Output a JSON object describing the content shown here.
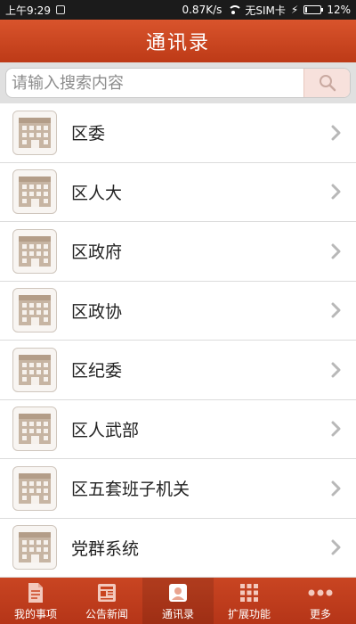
{
  "status_bar": {
    "time": "上午9:29",
    "speed": "0.87K/s",
    "sim": "无SIM卡",
    "battery": "12%",
    "battery_level": 0.12
  },
  "header": {
    "title": "通讯录"
  },
  "search": {
    "placeholder": "请输入搜索内容"
  },
  "contacts": {
    "items": [
      {
        "label": "区委"
      },
      {
        "label": "区人大"
      },
      {
        "label": "区政府"
      },
      {
        "label": "区政协"
      },
      {
        "label": "区纪委"
      },
      {
        "label": "区人武部"
      },
      {
        "label": "区五套班子机关"
      },
      {
        "label": "党群系统"
      }
    ]
  },
  "tabs": [
    {
      "label": "我的事项",
      "icon": "document-icon"
    },
    {
      "label": "公告新闻",
      "icon": "news-icon"
    },
    {
      "label": "通讯录",
      "icon": "contacts-icon",
      "active": true
    },
    {
      "label": "扩展功能",
      "icon": "grid-icon"
    },
    {
      "label": "更多",
      "icon": "more-icon"
    }
  ],
  "colors": {
    "header": "#c9431f",
    "tab_bar": "#be3c1b",
    "icon_building": "#c7b5a3"
  }
}
